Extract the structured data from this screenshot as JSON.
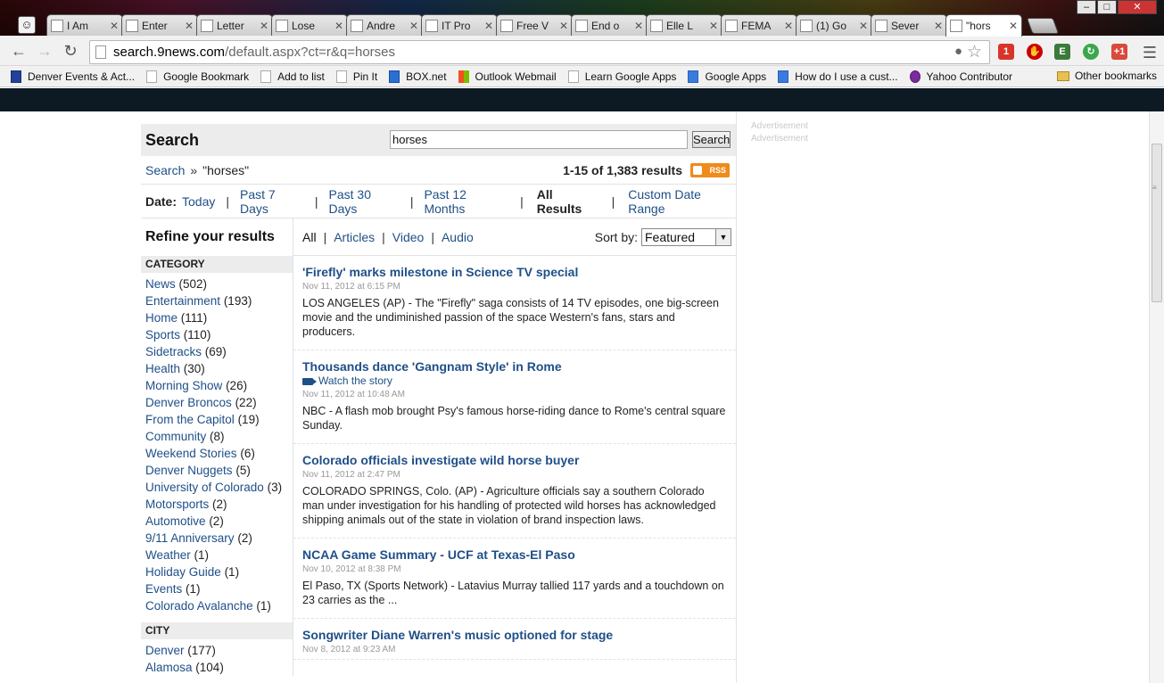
{
  "browser": {
    "tabs": [
      {
        "title": "I Am",
        "favicon": "page-icon"
      },
      {
        "title": "Enter",
        "favicon": "google-icon"
      },
      {
        "title": "Letter",
        "favicon": "green-icon"
      },
      {
        "title": "Lose",
        "favicon": "page-icon"
      },
      {
        "title": "Andre",
        "favicon": "ah-icon"
      },
      {
        "title": "IT Pro",
        "favicon": "blue-square-icon"
      },
      {
        "title": "Free V",
        "favicon": "free-icon"
      },
      {
        "title": "End o",
        "favicon": "page-icon"
      },
      {
        "title": "Elle L",
        "favicon": "elle-icon"
      },
      {
        "title": "FEMA",
        "favicon": "fema-icon"
      },
      {
        "title": "(1) Go",
        "favicon": "gplus-icon"
      },
      {
        "title": "Sever",
        "favicon": "panda-icon"
      },
      {
        "title": "\"hors",
        "favicon": "page-icon",
        "active": true
      }
    ],
    "url_host": "search.9news.com",
    "url_path": "/default.aspx?ct=r&q=horses",
    "ext_badge": "1",
    "bookmarks": [
      {
        "label": "Denver Events & Act...",
        "icon": "blue"
      },
      {
        "label": "Google Bookmark",
        "icon": "page"
      },
      {
        "label": "Add to list",
        "icon": "page"
      },
      {
        "label": "Pin It",
        "icon": "page"
      },
      {
        "label": "BOX.net",
        "icon": "b"
      },
      {
        "label": "Outlook Webmail",
        "icon": "ms"
      },
      {
        "label": "Learn Google Apps",
        "icon": "page"
      },
      {
        "label": "Google Apps",
        "icon": "g"
      },
      {
        "label": "How do I use a cust...",
        "icon": "g"
      },
      {
        "label": "Yahoo Contributor",
        "icon": "y"
      }
    ],
    "other_bookmarks": "Other bookmarks"
  },
  "ads": [
    "Advertisement",
    "Advertisement"
  ],
  "search": {
    "heading": "Search",
    "query": "horses",
    "button": "Search",
    "crumb_link": "Search",
    "crumb_sep": "»",
    "crumb_query": "\"horses\"",
    "count": "1-15 of 1,383 results",
    "rss": "RSS"
  },
  "date_filter": {
    "label": "Date:",
    "options": [
      "Today",
      "Past 7 Days",
      "Past 30 Days",
      "Past 12 Months",
      "All Results",
      "Custom Date Range"
    ],
    "selected": "All Results"
  },
  "refine": {
    "heading": "Refine your results",
    "category_heading": "CATEGORY",
    "categories": [
      {
        "name": "News",
        "count": "(502)"
      },
      {
        "name": "Entertainment",
        "count": "(193)"
      },
      {
        "name": "Home",
        "count": "(111)"
      },
      {
        "name": "Sports",
        "count": "(110)"
      },
      {
        "name": "Sidetracks",
        "count": "(69)"
      },
      {
        "name": "Health",
        "count": "(30)"
      },
      {
        "name": "Morning Show",
        "count": "(26)"
      },
      {
        "name": "Denver Broncos",
        "count": "(22)"
      },
      {
        "name": "From the Capitol",
        "count": "(19)"
      },
      {
        "name": "Community",
        "count": "(8)"
      },
      {
        "name": "Weekend Stories",
        "count": "(6)"
      },
      {
        "name": "Denver Nuggets",
        "count": "(5)"
      },
      {
        "name": "University of Colorado",
        "count": "(3)"
      },
      {
        "name": "Motorsports",
        "count": "(2)"
      },
      {
        "name": "Automotive",
        "count": "(2)"
      },
      {
        "name": "9/11 Anniversary",
        "count": "(2)"
      },
      {
        "name": "Weather",
        "count": "(1)"
      },
      {
        "name": "Holiday Guide",
        "count": "(1)"
      },
      {
        "name": "Events",
        "count": "(1)"
      },
      {
        "name": "Colorado Avalanche",
        "count": "(1)"
      }
    ],
    "city_heading": "CITY",
    "cities": [
      {
        "name": "Denver",
        "count": "(177)"
      },
      {
        "name": "Alamosa",
        "count": "(104)"
      }
    ]
  },
  "type_filter": {
    "options": [
      "All",
      "Articles",
      "Video",
      "Audio"
    ],
    "selected": "All",
    "sort_label": "Sort by:",
    "sort_value": "Featured"
  },
  "results": [
    {
      "title": "'Firefly' marks milestone in Science TV special",
      "date": "Nov 11, 2012 at 6:15 PM",
      "summary": "LOS ANGELES (AP) - The \"Firefly\" saga consists of 14 TV episodes, one big-screen movie and the undiminished passion of the space Western's fans, stars and producers."
    },
    {
      "title": "Thousands dance 'Gangnam Style' in Rome",
      "watch": "Watch the story",
      "date": "Nov 11, 2012 at 10:48 AM",
      "summary": "NBC - A flash mob brought Psy's famous horse-riding dance to Rome's central square Sunday."
    },
    {
      "title": "Colorado officials investigate wild horse buyer",
      "date": "Nov 11, 2012 at 2:47 PM",
      "summary": "COLORADO SPRINGS, Colo. (AP) - Agriculture officials say a southern Colorado man under investigation for his handling of protected wild horses has acknowledged shipping animals out of the state in violation of brand inspection laws."
    },
    {
      "title": "NCAA Game Summary - UCF at Texas-El Paso",
      "date": "Nov 10, 2012 at 8:38 PM",
      "summary": "El Paso, TX (Sports Network) - Latavius Murray tallied 117 yards and a touchdown on 23 carries as the ..."
    },
    {
      "title": "Songwriter Diane Warren's music optioned for stage",
      "date": "Nov 8, 2012 at 9:23 AM",
      "summary": ""
    }
  ]
}
